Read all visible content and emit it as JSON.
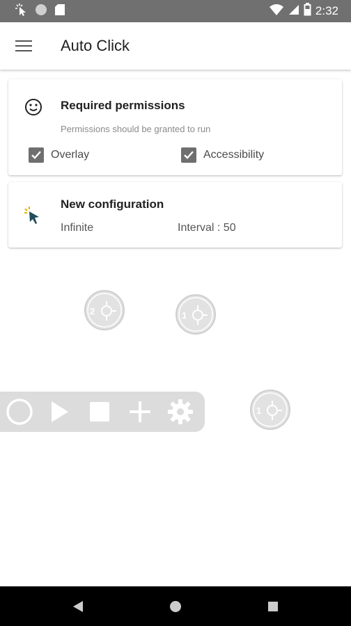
{
  "status_bar": {
    "time": "2:32",
    "icons": [
      "touch-icon",
      "circle-status-icon",
      "sd-card-icon",
      "wifi-icon",
      "cell-signal-icon",
      "battery-icon"
    ]
  },
  "app_bar": {
    "title": "Auto Click",
    "menu_icon": "hamburger-menu-icon"
  },
  "permissions_card": {
    "icon": "smiley-icon",
    "title": "Required permissions",
    "subtitle": "Permissions should be granted to run",
    "checkboxes": [
      {
        "label": "Overlay",
        "checked": true
      },
      {
        "label": "Accessibility",
        "checked": true
      }
    ]
  },
  "configuration_card": {
    "icon": "cursor-click-icon",
    "title": "New configuration",
    "mode": "Infinite",
    "interval": "Interval : 50"
  },
  "click_targets": [
    {
      "number": "2"
    },
    {
      "number": "1"
    },
    {
      "number": "1"
    }
  ],
  "overlay_toolbar": {
    "buttons": [
      "record-circle-icon",
      "play-icon",
      "stop-icon",
      "add-icon",
      "settings-gear-icon"
    ]
  },
  "nav_bar": {
    "buttons": [
      "back-icon",
      "home-icon",
      "recents-icon"
    ]
  },
  "colors": {
    "status_bar": "#707070",
    "checkbox": "#6f6f6f",
    "overlay": "#dcdcdc",
    "nav_bar": "#000000"
  }
}
